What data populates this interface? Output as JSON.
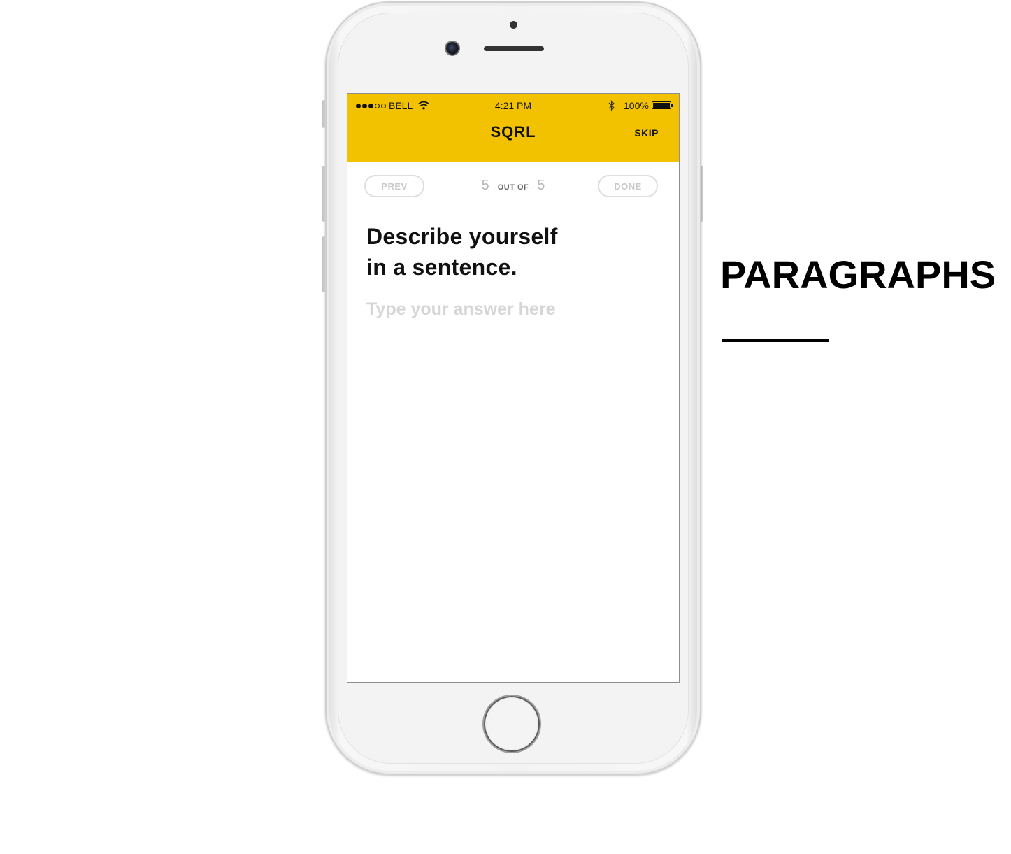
{
  "status_bar": {
    "carrier": "BELL",
    "time": "4:21 PM",
    "battery": "100%",
    "signal_bars_filled": 3,
    "signal_bars_total": 5
  },
  "header": {
    "title": "SQRL",
    "skip_label": "SKIP",
    "background_color": "#f2c200"
  },
  "pager": {
    "prev_label": "PREV",
    "done_label": "DONE",
    "current": "5",
    "separator": "OUT OF",
    "total": "5"
  },
  "question": {
    "text": "Describe yourself\nin a sentence."
  },
  "answer": {
    "value": "",
    "placeholder": "Type your answer here"
  },
  "side_heading": "PARAGRAPHS"
}
